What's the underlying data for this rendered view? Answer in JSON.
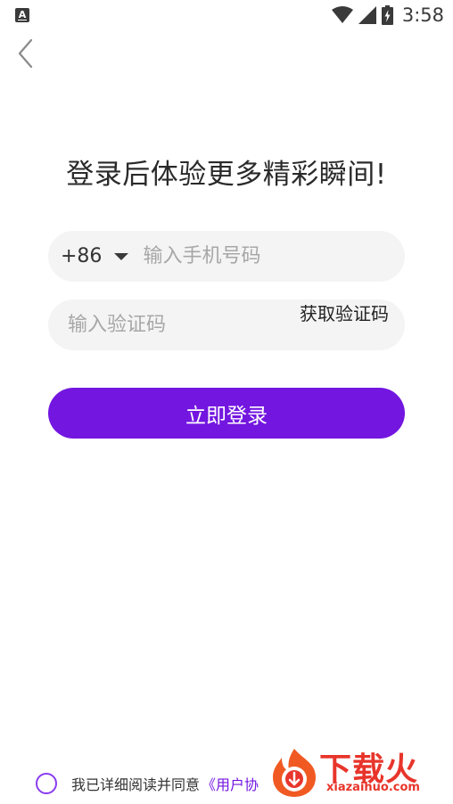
{
  "status_bar": {
    "notification_icon": "a-icon",
    "time": "3:58"
  },
  "header": {
    "back_icon": "chevron-left-icon"
  },
  "title": "登录后体验更多精彩瞬间!",
  "phone_field": {
    "country_code": "+86",
    "placeholder": "输入手机号码"
  },
  "code_field": {
    "placeholder": "输入验证码",
    "get_code_label": "获取验证码"
  },
  "login_button": "立即登录",
  "agreement": {
    "text": "我已详细阅读并同意",
    "link": "《用户协"
  },
  "watermark": {
    "title": "下载火",
    "domain": "xiazaihuo.com"
  },
  "colors": {
    "accent": "#7316e0",
    "field_bg": "#f4f4f5",
    "watermark": "#e8352b"
  }
}
